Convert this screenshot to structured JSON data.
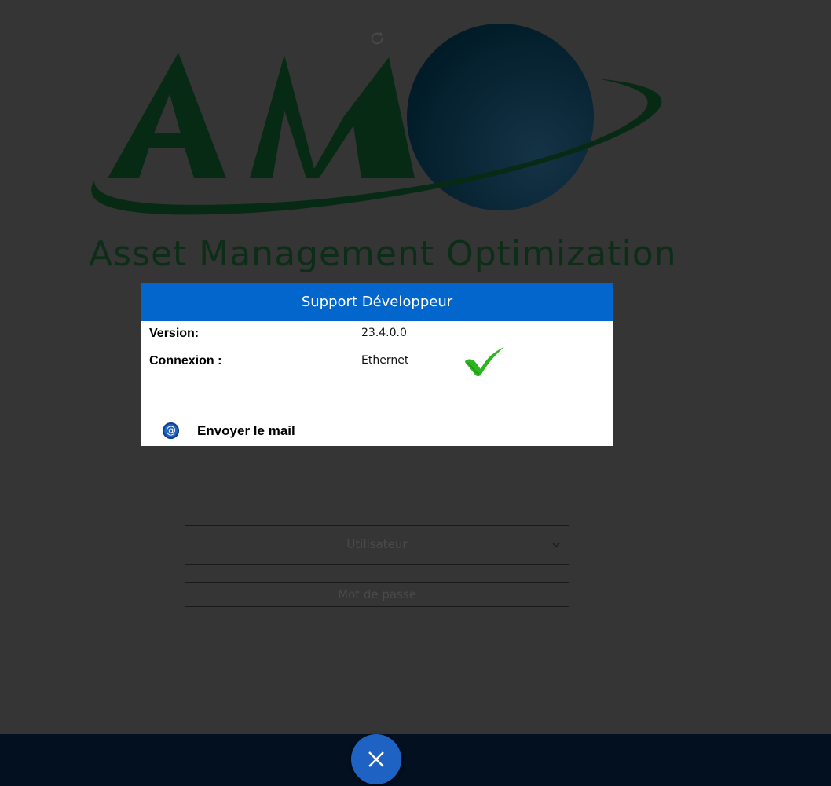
{
  "app": {
    "logo_text": "Asset Management Optimization",
    "logo_letters": "AMO"
  },
  "login": {
    "user_select": {
      "placeholder": "Utilisateur"
    },
    "password": {
      "placeholder": "Mot de passe"
    }
  },
  "dialog": {
    "title": "Support Développeur",
    "rows": [
      {
        "label": "Version:",
        "value": "23.4.0.0"
      },
      {
        "label": "Connexion :",
        "value": "Ethernet",
        "status_icon": "check-icon",
        "status": "connected"
      }
    ],
    "mail_action": {
      "label": "Envoyer le mail",
      "icon": "at-icon",
      "icon_glyph": "@"
    }
  },
  "footer": {
    "close_button_icon": "close-icon"
  },
  "colors": {
    "background": "#353535",
    "header_blue": "#0366cc",
    "fab_blue": "#1e63c4",
    "footer": "#02101f",
    "logo_green": "#0c2e18",
    "check_green": "#2cb51f"
  }
}
